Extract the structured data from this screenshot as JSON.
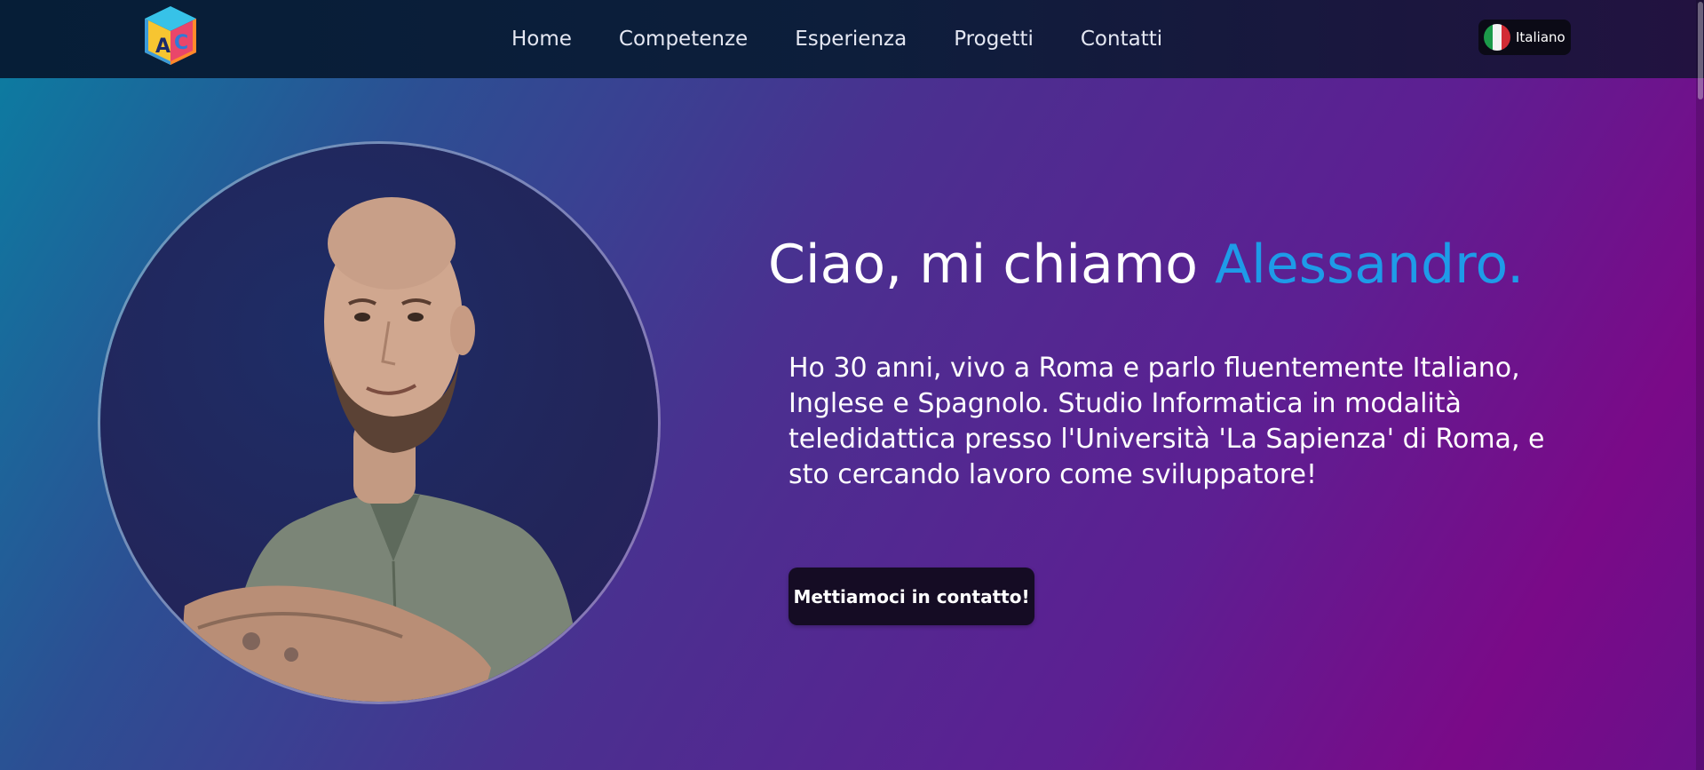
{
  "nav": {
    "links": [
      "Home",
      "Competenze",
      "Esperienza",
      "Progetti",
      "Contatti"
    ],
    "language_label": "Italiano"
  },
  "logo": {
    "letters": [
      "A",
      "C"
    ]
  },
  "hero": {
    "greeting": "Ciao, mi chiamo ",
    "name": "Alessandro.",
    "bio": "Ho 30 anni, vivo a Roma e parlo fluentemente Italiano, Inglese e Spagnolo. Studio Informatica in modalità teledidattica presso l'Università 'La Sapienza' di Roma, e sto cercando lavoro come sviluppatore!",
    "cta_label": "Mettiamoci in contatto!"
  },
  "colors": {
    "accent": "#1e9be8",
    "cta_bg": "#150c24",
    "flag_green": "#1c9a4a",
    "flag_white": "#f4f4f4",
    "flag_red": "#d22c35"
  },
  "icons": {
    "logo": "letter-cube-logo-icon",
    "language": "italian-flag-icon"
  }
}
